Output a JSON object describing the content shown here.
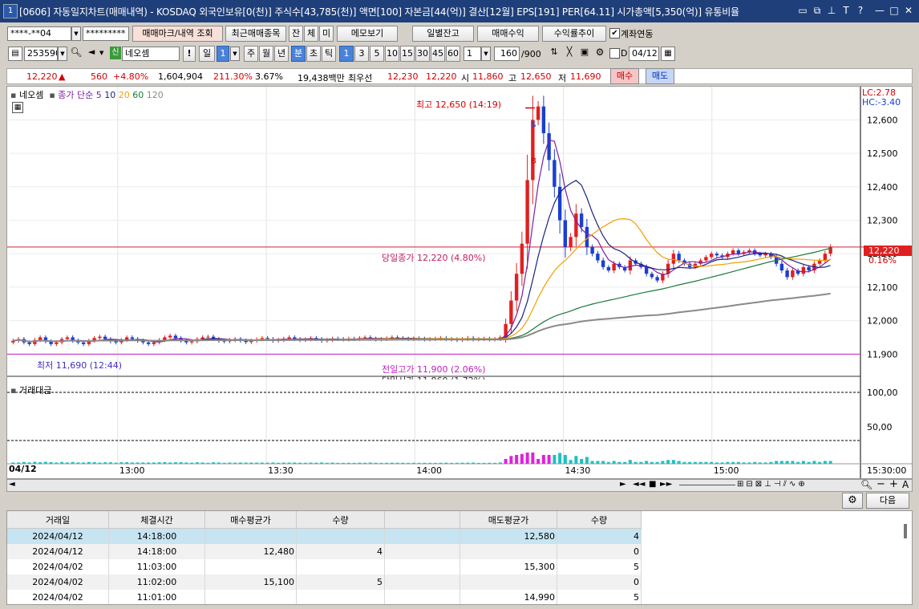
{
  "window": {
    "screen_no": "1",
    "title": "[0606] 자동일지차트(매매내역) - KOSDAQ 외국인보유[0(천)] 주식수[43,785(천)] 액면[100] 자본금[44(억)] 결산[12월] EPS[191] PER[64.11] 시가총액[5,350(억)] 유통비율"
  },
  "toolbar1": {
    "account": "****-**04",
    "password": "*********",
    "btn_trade_history": "매매마크/내역 조회",
    "btn_recent_trades": "최근매매종목",
    "btn_jan": "잔",
    "btn_che": "체",
    "btn_mi": "미",
    "btn_memo": "메모보기",
    "btn_daily_balance": "일별잔고",
    "btn_trade_return": "매매수익",
    "btn_return_trend": "수익률추이",
    "account_link_label": "계좌연동",
    "account_link_checked": true
  },
  "toolbar2": {
    "code": "253590",
    "credit_badge": "신",
    "stock_name": "네오셈",
    "btn_il": "일",
    "il_value": "1",
    "periods": [
      "주",
      "월",
      "년"
    ],
    "period_min": "분",
    "period_tick": "초",
    "period_ticks": "틱",
    "intervals": [
      "1",
      "3",
      "5",
      "10",
      "15",
      "30",
      "45",
      "60"
    ],
    "interval_selected": "1",
    "interval_box": "1",
    "count": "160",
    "count_max": "/900",
    "date_label": "D",
    "date_value": "04/12"
  },
  "pricebar": {
    "price": "12,220",
    "change_arrow": "▲",
    "change": "560",
    "change_pct": "+4.80%",
    "volume": "1,604,904",
    "volume_ratio": "211.30%",
    "turnover": "3.67%",
    "amount": "19,438백만",
    "best_label": "최우선",
    "best_ask": "12,230",
    "best_bid": "12,220",
    "open_label": "시",
    "open": "11,860",
    "high_label": "고",
    "high": "12,650",
    "low_label": "저",
    "low": "11,690",
    "buy_label": "매수",
    "sell_label": "매도"
  },
  "chart_legend": {
    "stock": "네오셈",
    "ma_label": "종가 단순",
    "ma": [
      {
        "period": "5",
        "color": "#7a1fa2"
      },
      {
        "period": "10",
        "color": "#1a237e"
      },
      {
        "period": "20",
        "color": "#f0a000"
      },
      {
        "period": "60",
        "color": "#1b7a3a"
      },
      {
        "period": "120",
        "color": "#8a8a8a"
      }
    ],
    "lc": "LC:2.78",
    "hc": "HC:-3.40",
    "volume_panel_label": "거래대금"
  },
  "annotations": {
    "high": "최고 12,650 (14:19)",
    "low": "최저 11,690 (12:44)",
    "today_close": "당일종가 12,220 (4.80%)",
    "prev_high": "전일고가 11,900 (2.06%)",
    "today_open_partial": "당일시가 11,860 (1.72%)",
    "last_price_tag": "12,220",
    "last_pct_tag": "0.16%",
    "sell_mark": "S",
    "buy_mark": "B"
  },
  "chart_data": {
    "type": "candlestick",
    "date": "04/12",
    "x_ticks": [
      "13:00",
      "13:30",
      "14:00",
      "14:30",
      "15:00",
      "15:30:00"
    ],
    "y_ticks": [
      "12,600",
      "12,500",
      "12,400",
      "12,300",
      "12,200",
      "12,100",
      "12,000",
      "11,900"
    ],
    "ylim": [
      11860,
      12680
    ],
    "volume_y_ticks": [
      "100,00",
      "50,00"
    ],
    "close_series": [
      11940,
      11945,
      11935,
      11930,
      11942,
      11950,
      11938,
      11930,
      11935,
      11945,
      11950,
      11940,
      11935,
      11930,
      11940,
      11948,
      11952,
      11945,
      11938,
      11935,
      11942,
      11950,
      11945,
      11940,
      11935,
      11930,
      11935,
      11942,
      11950,
      11955,
      11948,
      11940,
      11935,
      11938,
      11945,
      11950,
      11952,
      11945,
      11940,
      11938,
      11942,
      11945,
      11940,
      11936,
      11940,
      11944,
      11948,
      11945,
      11940,
      11942,
      11946,
      11950,
      11945,
      11942,
      11944,
      11948,
      11945,
      11940,
      11942,
      11946,
      11945,
      11944,
      11946,
      11945,
      11948,
      11950,
      11946,
      11944,
      11945,
      11947,
      11950,
      11948,
      11946,
      11945,
      11947,
      11946,
      11944,
      11945,
      11946,
      11948,
      11945,
      11944,
      11942,
      11945,
      11948,
      11944,
      11945,
      11946,
      11944,
      11945,
      11950,
      11990,
      12060,
      12140,
      12230,
      12420,
      12600,
      12640,
      12560,
      12480,
      12400,
      12300,
      12220,
      12250,
      12320,
      12280,
      12220,
      12200,
      12180,
      12160,
      12150,
      12170,
      12160,
      12150,
      12180,
      12170,
      12160,
      12140,
      12130,
      12120,
      12140,
      12170,
      12200,
      12180,
      12170,
      12160,
      12170,
      12180,
      12190,
      12200,
      12195,
      12190,
      12200,
      12210,
      12200,
      12205,
      12210,
      12200,
      12195,
      12200,
      12190,
      12170,
      12150,
      12130,
      12150,
      12140,
      12160,
      12150,
      12170,
      12180,
      12200,
      12220
    ],
    "x_range_minutes": [
      "12:38",
      "15:30"
    ]
  },
  "grid": {
    "columns": [
      "거래일",
      "체결시간",
      "매수평균가",
      "수량",
      "",
      "매도평균가",
      "수량"
    ],
    "rows": [
      [
        "2024/04/12",
        "14:18:00",
        "",
        "",
        "",
        "12,580",
        "4"
      ],
      [
        "2024/04/12",
        "14:18:00",
        "12,480",
        "4",
        "",
        "",
        "0"
      ],
      [
        "2024/04/02",
        "11:03:00",
        "",
        "",
        "",
        "15,300",
        "5"
      ],
      [
        "2024/04/02",
        "11:02:00",
        "15,100",
        "5",
        "",
        "",
        "0"
      ],
      [
        "2024/04/02",
        "11:01:00",
        "",
        "",
        "",
        "14,990",
        "5"
      ]
    ],
    "next_button": "다음"
  }
}
